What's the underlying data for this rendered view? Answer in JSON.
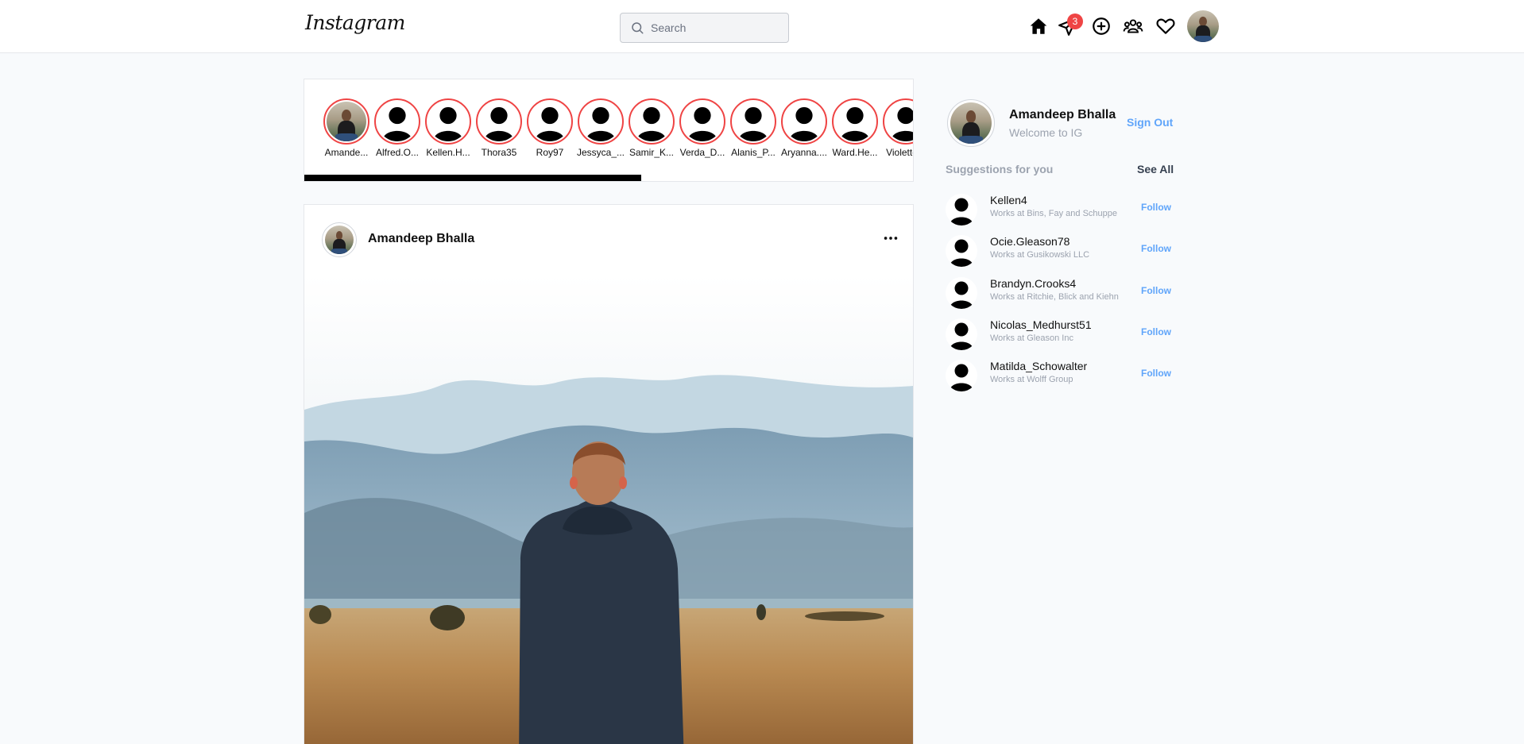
{
  "header": {
    "logo": "Instagram",
    "search_placeholder": "Search",
    "messages_badge": "3",
    "icons": [
      "home-icon",
      "send-icon",
      "add-post-icon",
      "people-icon",
      "heart-icon"
    ]
  },
  "stories": {
    "items": [
      {
        "label": "Amande...",
        "avatar": "photo"
      },
      {
        "label": "Alfred.O...",
        "avatar": "silhouette"
      },
      {
        "label": "Kellen.H...",
        "avatar": "silhouette"
      },
      {
        "label": "Thora35",
        "avatar": "silhouette"
      },
      {
        "label": "Roy97",
        "avatar": "silhouette"
      },
      {
        "label": "Jessyca_...",
        "avatar": "silhouette"
      },
      {
        "label": "Samir_K...",
        "avatar": "silhouette"
      },
      {
        "label": "Verda_D...",
        "avatar": "silhouette"
      },
      {
        "label": "Alanis_P...",
        "avatar": "silhouette"
      },
      {
        "label": "Aryanna....",
        "avatar": "silhouette"
      },
      {
        "label": "Ward.He...",
        "avatar": "silhouette"
      },
      {
        "label": "Violette...",
        "avatar": "silhouette"
      }
    ],
    "scroll_progress": 0.553
  },
  "post": {
    "username": "Amandeep Bhalla",
    "more_icon": "more-horizontal-icon"
  },
  "sidebar": {
    "profile": {
      "name": "Amandeep Bhalla",
      "subtitle": "Welcome to IG",
      "signout": "Sign Out"
    },
    "suggestions_title": "Suggestions for you",
    "see_all": "See All",
    "suggestions": [
      {
        "name": "Kellen4",
        "work": "Works at Bins, Fay and Schuppe",
        "action": "Follow"
      },
      {
        "name": "Ocie.Gleason78",
        "work": "Works at Gusikowski LLC",
        "action": "Follow"
      },
      {
        "name": "Brandyn.Crooks4",
        "work": "Works at Ritchie, Blick and Kiehn",
        "action": "Follow"
      },
      {
        "name": "Nicolas_Medhurst51",
        "work": "Works at Gleason Inc",
        "action": "Follow"
      },
      {
        "name": "Matilda_Schowalter",
        "work": "Works at Wolff Group",
        "action": "Follow"
      }
    ]
  },
  "colors": {
    "story_ring": "#ef4444",
    "link_blue": "#60a5fa",
    "badge_red": "#ef4444"
  }
}
